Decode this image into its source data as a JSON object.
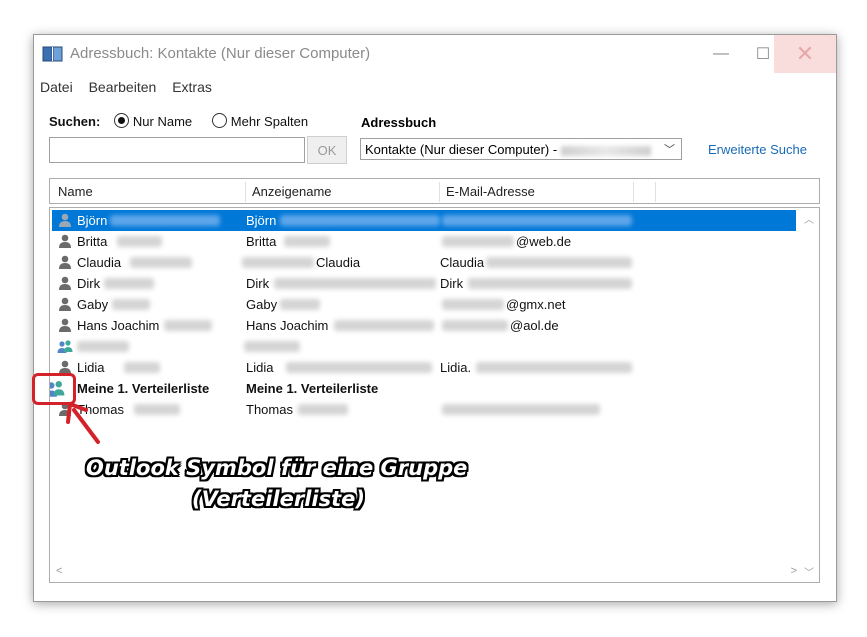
{
  "window": {
    "title": "Adressbuch: Kontakte (Nur dieser Computer)",
    "minimize": "—",
    "maximize": "☐",
    "close": "✕"
  },
  "menu": [
    "Datei",
    "Bearbeiten",
    "Extras"
  ],
  "search": {
    "label": "Suchen:",
    "option_name": "Nur Name",
    "option_more": "Mehr Spalten",
    "selected": "Nur Name",
    "input_value": "",
    "ok_label": "OK"
  },
  "addressbook": {
    "label": "Adressbuch",
    "selected_value": "Kontakte (Nur dieser Computer) -",
    "advanced_search": "Erweiterte Suche"
  },
  "columns": [
    "Name",
    "Anzeigename",
    "E-Mail-Adresse"
  ],
  "rows": [
    {
      "name": "Björn",
      "display": "Björn",
      "email": "",
      "icon": "person-icon",
      "selected": true
    },
    {
      "name": "Britta",
      "display": "Britta",
      "email": "@web.de",
      "icon": "person-icon"
    },
    {
      "name": "Claudia",
      "display": "Claudia",
      "email": "Claudia",
      "icon": "person-icon"
    },
    {
      "name": "Dirk",
      "display": "Dirk",
      "email": "Dirk",
      "icon": "person-icon"
    },
    {
      "name": "Gaby",
      "display": "Gaby",
      "email": "@gmx.net",
      "icon": "person-icon"
    },
    {
      "name": "Hans Joachim",
      "display": "Hans Joachim",
      "email": "@aol.de",
      "icon": "person-icon"
    },
    {
      "name": "",
      "display": "",
      "email": "",
      "icon": "group-icon"
    },
    {
      "name": "Lidia",
      "display": "Lidia",
      "email": "Lidia.",
      "icon": "person-icon"
    },
    {
      "name": "Meine 1. Verteilerliste",
      "display": "Meine 1. Verteilerliste",
      "email": "",
      "icon": "group-icon",
      "bold": true
    },
    {
      "name": "Thomas",
      "display": "Thomas",
      "email": "",
      "icon": "person-icon"
    }
  ],
  "annotation": {
    "line1": "Outlook Symbol für eine Gruppe",
    "line2": "(Verteilerliste)"
  },
  "colors": {
    "selection": "#0078d7",
    "link": "#1a6bb8",
    "highlight_red": "#d3222a"
  }
}
